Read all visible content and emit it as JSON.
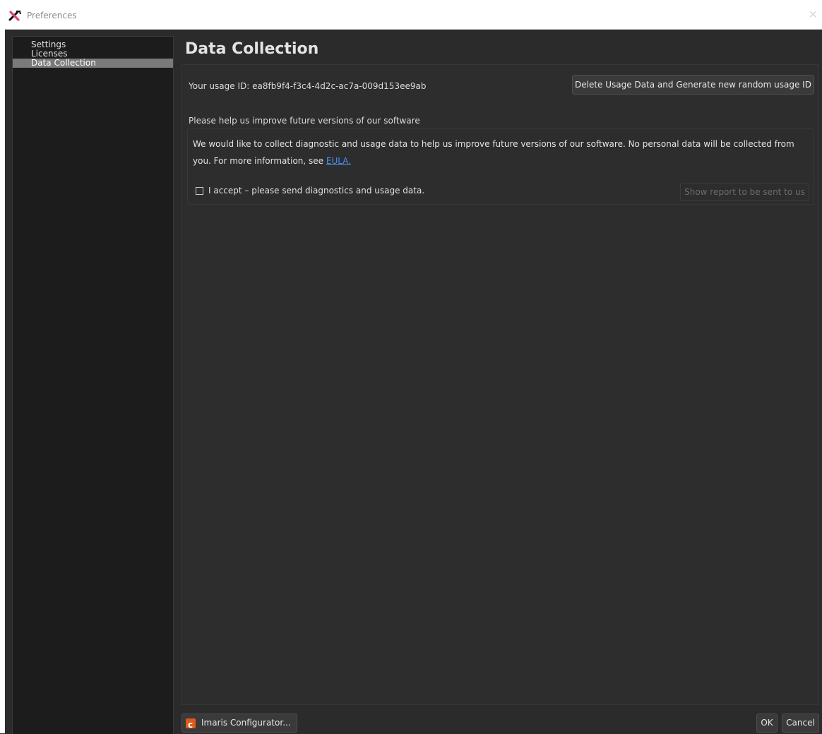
{
  "window": {
    "title": "Preferences",
    "close_glyph": "✕",
    "icon": "tools-icon"
  },
  "sidebar": {
    "items": [
      {
        "label": "Settings",
        "selected": false
      },
      {
        "label": "Licenses",
        "selected": false
      },
      {
        "label": "Data Collection",
        "selected": true
      }
    ]
  },
  "main": {
    "title": "Data Collection",
    "usage_id_text": "Your usage ID: ea8fb9f4-f3c4-4d2c-ac7a-009d153ee9ab",
    "delete_button_label": "Delete Usage Data and Generate new random usage ID",
    "help_heading": "Please help us improve future versions of our software",
    "description_text": "We would like to collect diagnostic and usage data to help us improve future versions of our software. No personal data will be collected from you. For more information, see ",
    "eula_link": "EULA.",
    "accept_checkbox": {
      "checked": false,
      "label": "I accept – please send diagnostics and usage data."
    },
    "report_button_label": "Show report to be sent to us"
  },
  "footer": {
    "configurator_label": "Imaris Configurator...",
    "configurator_icon": "configurator-icon",
    "ok_label": "OK",
    "cancel_label": "Cancel"
  },
  "colors": {
    "background": "#2b2b2b",
    "sidebar_bg": "#1c1c1c",
    "selected_item": "#7a7a7a",
    "link": "#4a8ef0",
    "configurator_accent": "#e05a1c"
  }
}
